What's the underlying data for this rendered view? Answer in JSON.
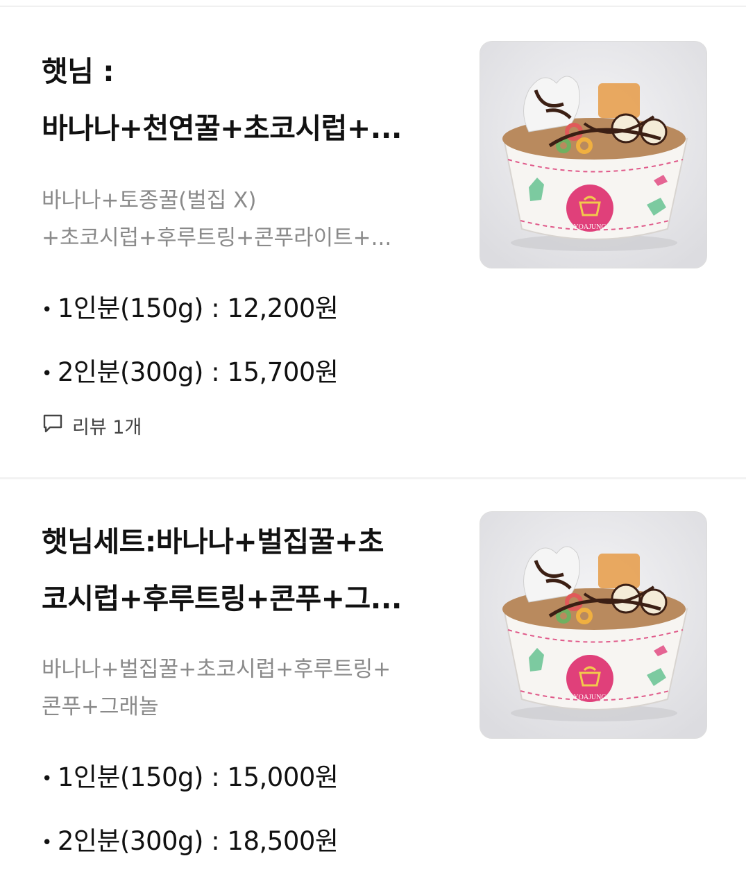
{
  "items": [
    {
      "title_lines": [
        "햇님 :",
        "바나나+천연꿀+초코시럽+..."
      ],
      "desc_lines": [
        "바나나+토종꿀(벌집 X)",
        "+초코시럽+후루트링+콘푸라이트+..."
      ],
      "prices": [
        {
          "label": "1인분(150g) : 12,200원"
        },
        {
          "label": "2인분(300g) : 15,700원"
        }
      ],
      "review": {
        "icon": "speech-bubble-icon",
        "label": "리뷰 1개"
      },
      "image": {
        "brand_text": "YOAJUNG"
      }
    },
    {
      "title_lines": [
        "햇님세트:바나나+벌집꿀+초",
        "코시럽+후루트링+콘푸+그..."
      ],
      "desc_lines": [
        "바나나+벌집꿀+초코시럽+후루트링+",
        "콘푸+그래놀"
      ],
      "prices": [
        {
          "label": "1인분(150g) : 15,000원"
        },
        {
          "label": "2인분(300g) : 18,500원"
        }
      ],
      "image": {
        "brand_text": "YOAJUNG"
      }
    }
  ],
  "colors": {
    "title": "#111111",
    "description": "#8a8a8a",
    "divider": "#f2f2f2",
    "thumb_bg": "#e8e8ec",
    "brand_pink": "#e0407a"
  }
}
